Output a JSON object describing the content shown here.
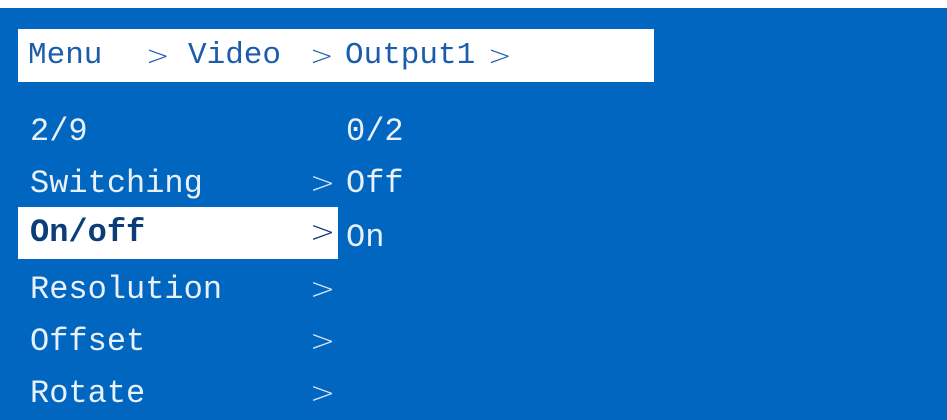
{
  "breadcrumb": {
    "items": [
      "Menu",
      "Video",
      "Output1"
    ],
    "separator": ">"
  },
  "menu": {
    "position": "2/9",
    "chevron": ">",
    "items": [
      {
        "label": "Switching"
      },
      {
        "label": "On/off"
      },
      {
        "label": "Resolution"
      },
      {
        "label": "Offset"
      },
      {
        "label": "Rotate"
      }
    ],
    "selected_index": 1
  },
  "submenu": {
    "position": "0/2",
    "options": [
      "Off",
      "On"
    ]
  },
  "colors": {
    "background": "#0066bf",
    "highlight": "#ffffff",
    "text": "#e8f0fa"
  }
}
